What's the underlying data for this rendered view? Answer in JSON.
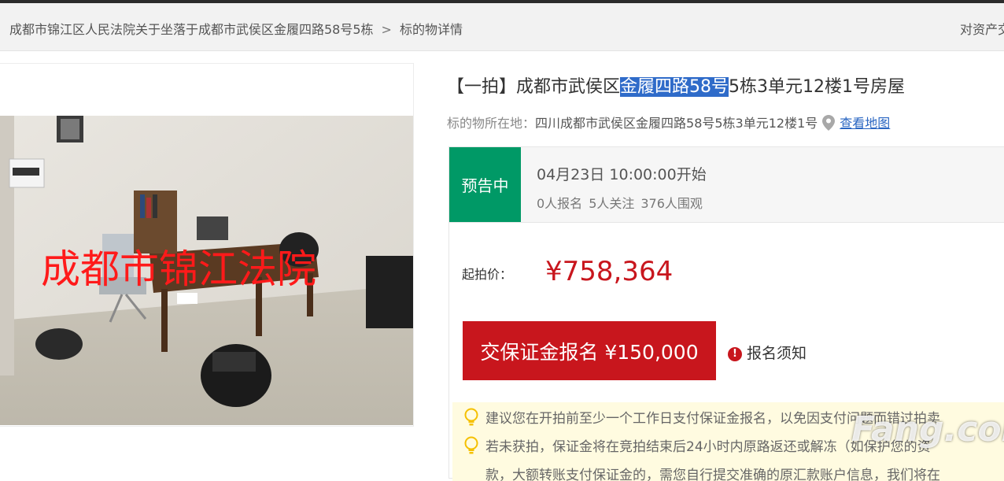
{
  "breadcrumb": {
    "items": [
      "成都市锦江区人民法院关于坐落于成都市武侯区金履四路58号5栋",
      "标的物详情"
    ],
    "separator": ">",
    "right_link": "对资产交"
  },
  "photo": {
    "overlay_text": "成都市锦江法院"
  },
  "item": {
    "title_before": "【一拍】成都市武侯区",
    "title_highlight": "金履四路58号",
    "title_after": "5栋3单元12楼1号房屋",
    "location_label": "标的物所在地：",
    "location_value": "四川成都市武侯区金履四路58号5栋3单元12楼1号",
    "map_link": "查看地图"
  },
  "auction": {
    "status_badge": "预告中",
    "start_time": "04月23日 10:00:00开始",
    "stats": [
      "0人报名",
      "5人关注",
      "376人围观"
    ],
    "price_label": "起拍价：",
    "price": "¥758,364",
    "deposit_button": "交保证金报名 ¥150,000",
    "notice_link": "报名须知",
    "notice_icon": "!",
    "tips": [
      "建议您在开拍前至少一个工作日支付保证金报名，以免因支付问题而错过拍卖",
      "若未获拍，保证金将在竞拍结束后24小时内原路返还或解冻（如保护您的资",
      "款，大额转账支付保证金的，需您自行提交准确的原汇款账户信息，我们将在"
    ]
  },
  "watermark": "Fang.com",
  "colors": {
    "status_green": "#009966",
    "price_red": "#c8161d",
    "highlight_blue": "#2f6bc9",
    "link_blue": "#2a66c2",
    "tip_bg": "#fffbe0"
  },
  "icons": [
    "location-pin-icon",
    "lightbulb-icon",
    "exclamation-icon"
  ]
}
